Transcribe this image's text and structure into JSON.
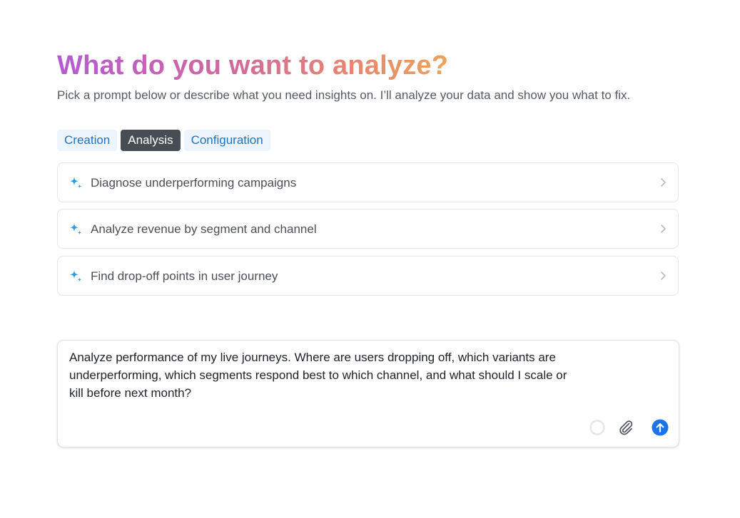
{
  "header": {
    "title": "What do you want to analyze?",
    "subtitle": "Pick a prompt below or describe what you need insights on. I’ll analyze your data and show you what to fix."
  },
  "tabs": [
    {
      "label": "Creation",
      "active": false
    },
    {
      "label": "Analysis",
      "active": true
    },
    {
      "label": "Configuration",
      "active": false
    }
  ],
  "prompts": [
    {
      "label": "Diagnose underperforming campaigns",
      "icon": "sparkle-icon"
    },
    {
      "label": "Analyze revenue by segment and channel",
      "icon": "sparkle-icon"
    },
    {
      "label": "Find drop-off points in user journey",
      "icon": "sparkle-icon"
    }
  ],
  "composer": {
    "text": "Analyze performance of my live journeys. Where are users dropping off, which variants are underperforming, which segments respond best to which channel, and what should I scale or kill before next month?",
    "icons": [
      "status-circle-icon",
      "paperclip-icon",
      "send-arrow-icon"
    ]
  },
  "colors": {
    "accent": "#1a73e8",
    "sparkle": "#2e9be0",
    "tab_active_bg": "#474c55",
    "tab_bg": "#eef4fb",
    "tab_text": "#1d72c6",
    "title_gradient": [
      "#b55bd2",
      "#d06a9c",
      "#e58670",
      "#eca35a"
    ]
  }
}
